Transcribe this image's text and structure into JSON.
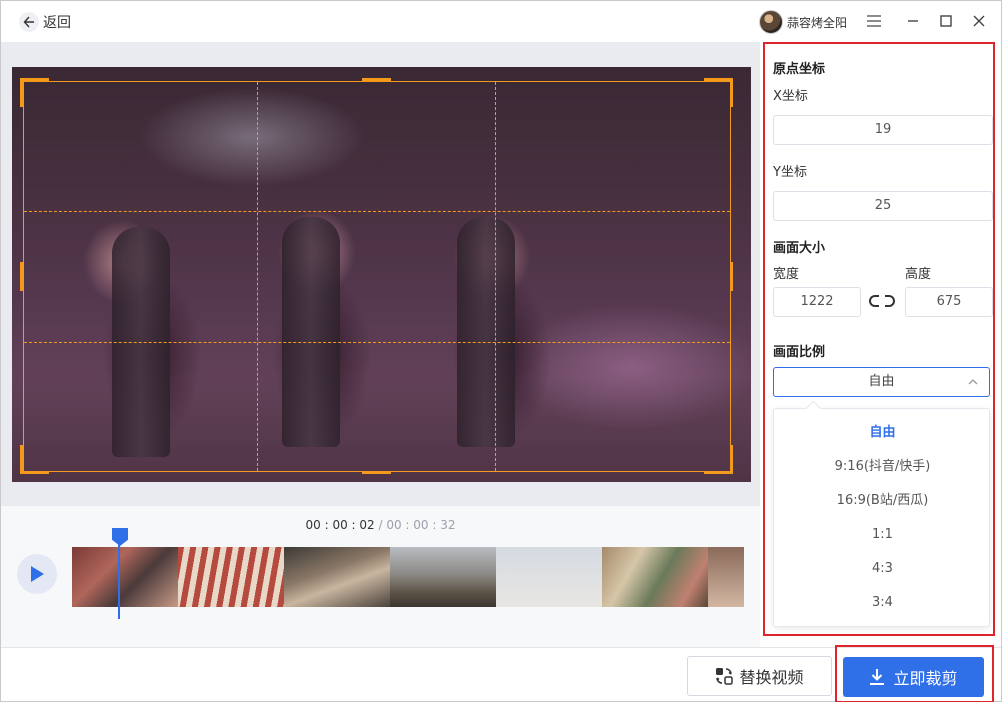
{
  "header": {
    "back_label": "返回",
    "user_name": "蒜容烤全阳"
  },
  "preview": {
    "current_time": "00 : 00 : 02",
    "separator": " / ",
    "total_time": "00 : 00 : 32"
  },
  "panel": {
    "origin_title": "原点坐标",
    "x_label": "X坐标",
    "x_value": "19",
    "y_label": "Y坐标",
    "y_value": "25",
    "size_title": "画面大小",
    "width_label": "宽度",
    "width_value": "1222",
    "height_label": "高度",
    "height_value": "675",
    "ratio_title": "画面比例",
    "ratio_selected": "自由",
    "ratio_options": [
      "自由",
      "9:16(抖音/快手)",
      "16:9(B站/西瓜)",
      "1:1",
      "4:3",
      "3:4"
    ]
  },
  "footer": {
    "replace_label": "替换视频",
    "crop_label": "立即裁剪"
  },
  "colors": {
    "accent": "#2f6fe8",
    "crop_frame": "#f39a1c",
    "highlight": "#e0242b"
  }
}
